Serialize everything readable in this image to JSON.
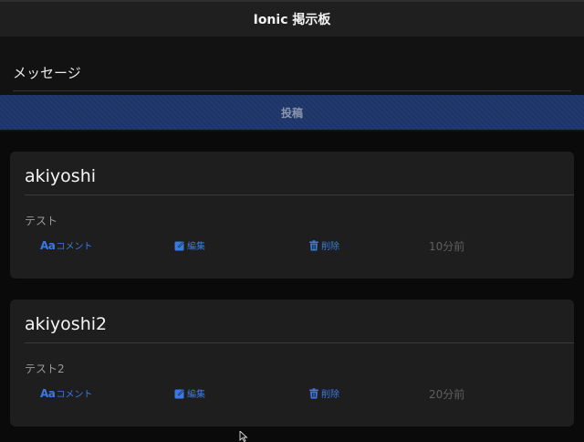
{
  "header": {
    "title": "Ionic 掲示板"
  },
  "compose": {
    "message_placeholder": "メッセージ",
    "post_label": "投稿"
  },
  "posts": [
    {
      "author": "akiyoshi",
      "message": "テスト",
      "comment_prefix": "Aa",
      "comment_label": "コメント",
      "edit_label": "編集",
      "delete_label": "削除",
      "time": "10分前"
    },
    {
      "author": "akiyoshi2",
      "message": "テスト2",
      "comment_prefix": "Aa",
      "comment_label": "コメント",
      "edit_label": "編集",
      "delete_label": "削除",
      "time": "20分前"
    }
  ],
  "colors": {
    "accent": "#3b78e7",
    "post_button_bg": "#1c3468",
    "card_bg": "#1e1e1e",
    "toolbar_bg": "#1f1f1f"
  },
  "icons": {
    "comment": "text-aa-icon",
    "edit": "edit-icon",
    "delete": "trash-icon"
  }
}
